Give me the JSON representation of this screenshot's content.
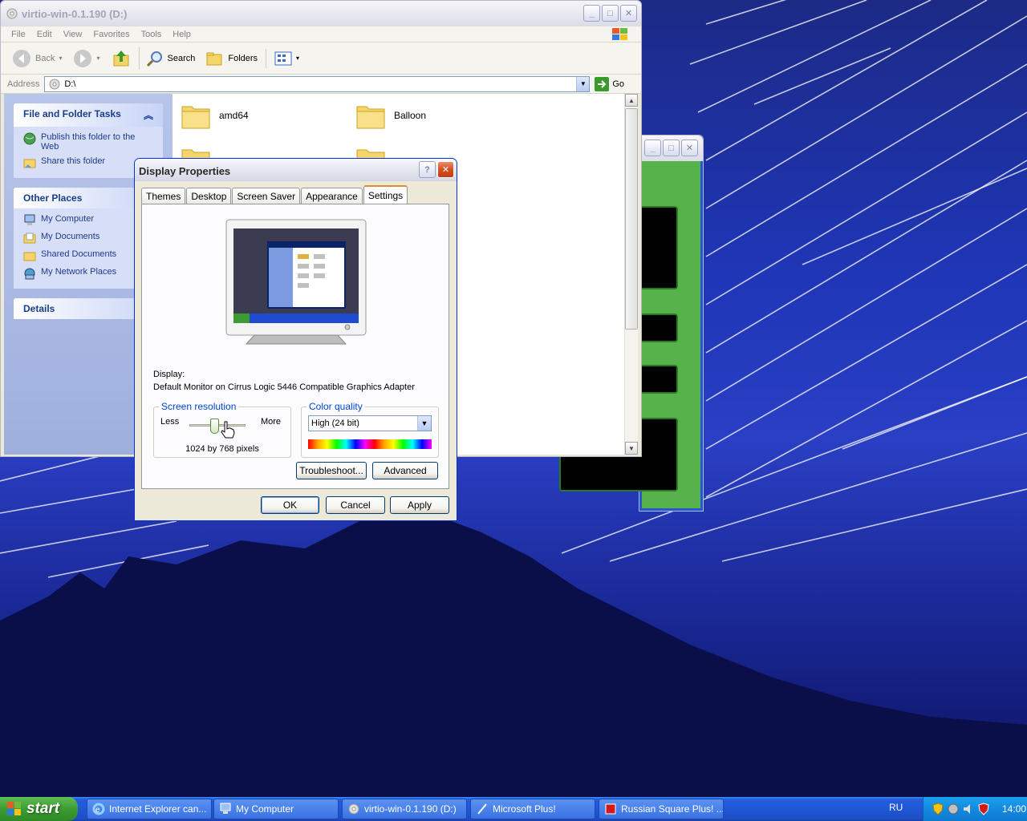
{
  "explorer": {
    "title": "virtio-win-0.1.190 (D:)",
    "menu": [
      "File",
      "Edit",
      "View",
      "Favorites",
      "Tools",
      "Help"
    ],
    "toolbar": {
      "back": "Back",
      "search": "Search",
      "folders": "Folders"
    },
    "address": {
      "label": "Address",
      "value": "D:\\",
      "go": "Go"
    },
    "tasks": {
      "file_folder": {
        "title": "File and Folder Tasks",
        "items": [
          "Publish this folder to the Web",
          "Share this folder"
        ]
      },
      "other_places": {
        "title": "Other Places",
        "items": [
          "My Computer",
          "My Documents",
          "Shared Documents",
          "My Network Places"
        ]
      },
      "details": {
        "title": "Details"
      }
    },
    "folders": [
      "amd64",
      "Balloon"
    ]
  },
  "dialog": {
    "title": "Display Properties",
    "tabs": [
      "Themes",
      "Desktop",
      "Screen Saver",
      "Appearance",
      "Settings"
    ],
    "active_tab": "Settings",
    "display_label": "Display:",
    "display_value": "Default Monitor on Cirrus Logic 5446 Compatible Graphics Adapter",
    "resolution": {
      "legend": "Screen resolution",
      "less": "Less",
      "more": "More",
      "value": "1024 by 768 pixels",
      "slider_fraction": 0.45
    },
    "color_quality": {
      "legend": "Color quality",
      "selected": "High (24 bit)"
    },
    "buttons": {
      "troubleshoot": "Troubleshoot...",
      "advanced": "Advanced",
      "ok": "OK",
      "cancel": "Cancel",
      "apply": "Apply"
    }
  },
  "taskbar": {
    "start": "start",
    "tasks": [
      "Internet Explorer can...",
      "My Computer",
      "virtio-win-0.1.190 (D:)",
      "Microsoft Plus!",
      "Russian Square Plus! ..."
    ],
    "language": "RU",
    "clock": "14:00"
  },
  "colors": {
    "xp_blue": "#0831d9",
    "taskbar": "#245edb",
    "start_green": "#3c9b32",
    "tab_accent": "#e68b2c"
  }
}
